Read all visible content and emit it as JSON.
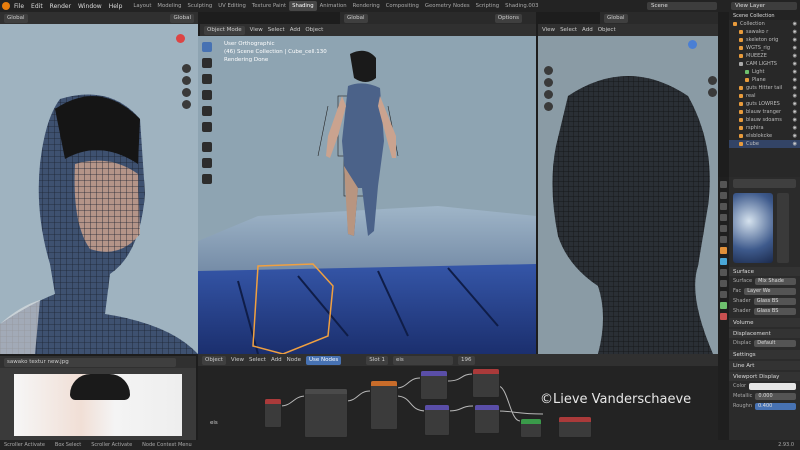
{
  "topbar": {
    "menus": [
      "File",
      "Edit",
      "Render",
      "Window",
      "Help"
    ],
    "workspaces": [
      "Layout",
      "Modeling",
      "Sculpting",
      "UV Editing",
      "Texture Paint",
      "Shading",
      "Animation",
      "Rendering",
      "Compositing",
      "Geometry Nodes",
      "Scripting",
      "Shading.003"
    ],
    "active_workspace": "Shading",
    "scene": "Scene",
    "view_layer": "View Layer"
  },
  "left_viewport": {
    "header_left": "Global",
    "header_mode": "Global"
  },
  "center_viewport": {
    "mode": "Object Mode",
    "menus": [
      "View",
      "Select",
      "Add",
      "Object"
    ],
    "transform": "Global",
    "options": "Options",
    "overlay": {
      "line1": "User Orthographic",
      "line2": "(46) Scene Collection | Cube_cell.130",
      "line3": "Rendering Done"
    }
  },
  "right_viewport": {
    "menus": [
      "View",
      "Select",
      "Add",
      "Object"
    ],
    "transform": "Global"
  },
  "outliner": {
    "title": "Scene Collection",
    "items": [
      {
        "label": "Collection"
      },
      {
        "label": "sawako r"
      },
      {
        "label": "skeleton orig"
      },
      {
        "label": "WGTS_rig"
      },
      {
        "label": "MUEEZE"
      },
      {
        "label": "CAM LIGHTS"
      },
      {
        "label": "Light"
      },
      {
        "label": "Plane"
      },
      {
        "label": "guts Hitter tail"
      },
      {
        "label": "real"
      },
      {
        "label": "guts LOWRES"
      },
      {
        "label": "blauw tranger"
      },
      {
        "label": "blauw sdoams"
      },
      {
        "label": "rsphira"
      },
      {
        "label": "elsblokcke"
      },
      {
        "label": "Cube"
      }
    ]
  },
  "properties": {
    "surface_header": "Surface",
    "surface_label": "Surface",
    "surface_value": "Mix Shade",
    "fac_label": "Fac",
    "fac_value": "Layer We",
    "shader1_label": "Shader",
    "shader1_value": "Glass BS",
    "shader2_label": "Shader",
    "shader2_value": "Glass BS",
    "volume_header": "Volume",
    "displacement_header": "Displacement",
    "displacement_label": "Displac",
    "displacement_value": "Default",
    "settings_header": "Settings",
    "lineart_header": "Line Art",
    "viewport_display_header": "Viewport Display",
    "color_label": "Color",
    "metallic_label": "Metallic",
    "metallic_value": "0.000",
    "roughness_label": "Roughn",
    "roughness_value": "0.400"
  },
  "image_editor": {
    "image_name": "sawako textur new.jpg"
  },
  "node_editor": {
    "mode": "Object",
    "menus": [
      "View",
      "Select",
      "Add",
      "Node"
    ],
    "use_nodes": "Use Nodes",
    "slot": "Slot 1",
    "material": "eis",
    "users": "196",
    "label": "eis",
    "watermark": "©Lieve Vanderschaeve"
  },
  "statusbar": {
    "items": [
      "Scroller Activate",
      "Box Select",
      "Scroller Activate",
      "Node Context Menu"
    ],
    "version": "2.93.0"
  },
  "colors": {
    "accent": "#4772b3",
    "brand": "#e87d0d",
    "selection": "#f0a040"
  }
}
